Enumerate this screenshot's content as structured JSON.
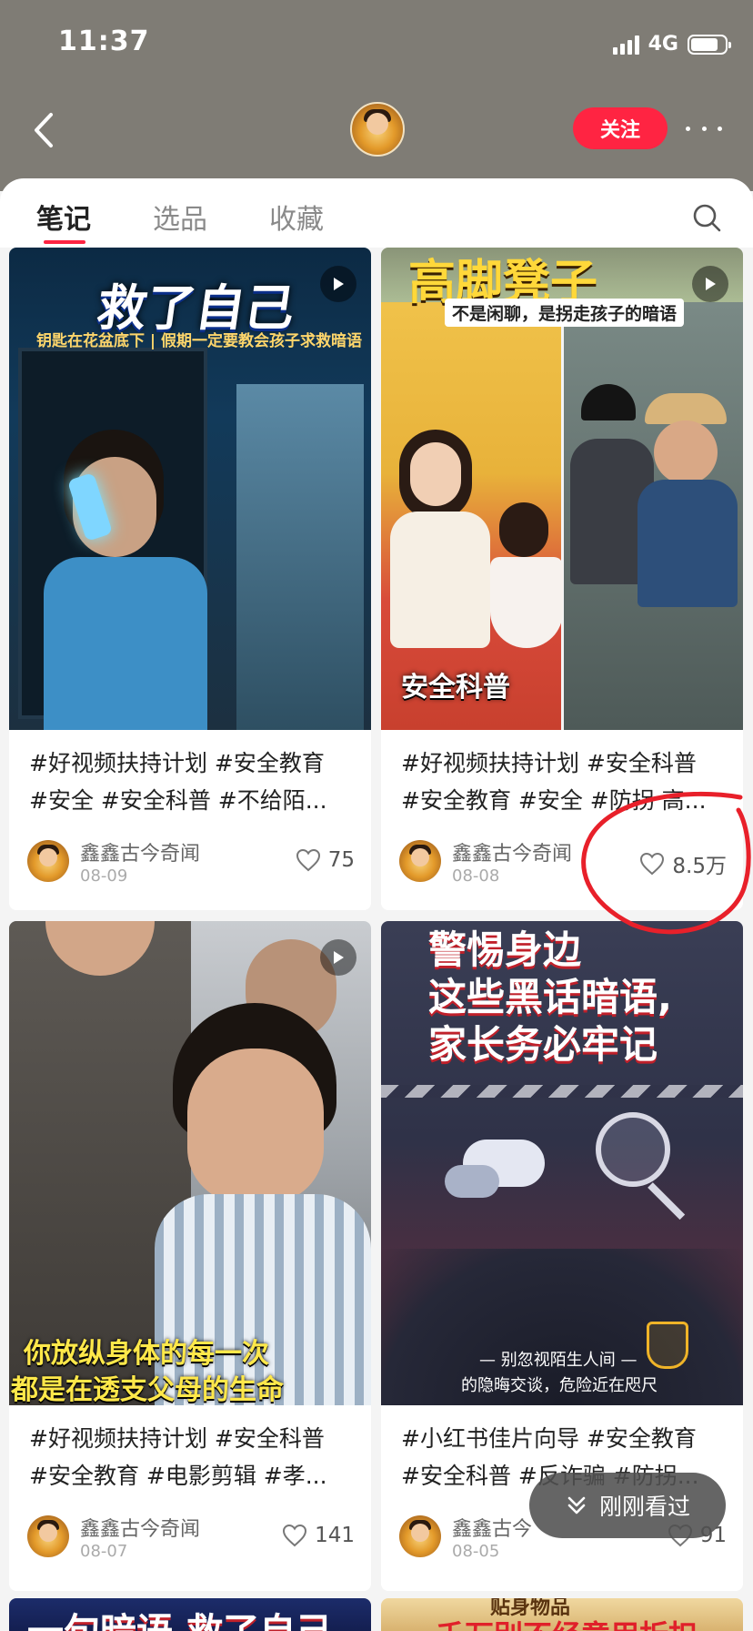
{
  "status_bar": {
    "time": "11:37",
    "network": "4G",
    "battery_level": 0.8
  },
  "header": {
    "follow_label": "关注"
  },
  "tabs": [
    {
      "label": "笔记",
      "active": true
    },
    {
      "label": "选品",
      "active": false
    },
    {
      "label": "收藏",
      "active": false
    }
  ],
  "notes": [
    {
      "tags_line1": "#好视频扶持计划 #安全教育",
      "tags_line2": "#安全 #安全科普 #不给陌...",
      "author": "鑫鑫古今奇闻",
      "date": "08-09",
      "likes": "75",
      "cover_text": [
        "救了自己",
        "钥匙在花盆底下 | 假期一定要教会孩子求救暗语"
      ]
    },
    {
      "tags_line1": "#好视频扶持计划 #安全科普",
      "tags_line2": "#安全教育 #安全 #防拐 高...",
      "author": "鑫鑫古今奇闻",
      "date": "08-08",
      "likes": "8.5万",
      "cover_text": [
        "高脚凳子",
        "不是闲聊，是拐走孩子的暗语",
        "安全科普"
      ]
    },
    {
      "tags_line1": "#好视频扶持计划 #安全科普",
      "tags_line2": "#安全教育 #电影剪辑 #孝...",
      "author": "鑫鑫古今奇闻",
      "date": "08-07",
      "likes": "141",
      "cover_text": [
        "你放纵身体的每一次",
        "都是在透支父母的生命"
      ]
    },
    {
      "tags_line1": "#小红书佳片向导 #安全教育",
      "tags_line2": "#安全科普 #反诈骗 #防拐...",
      "author": "鑫鑫古今",
      "date": "08-05",
      "likes": "91",
      "cover_text": [
        "警惕身边",
        "这些黑话暗语,",
        "家长务必牢记",
        "— 别忽视陌生人间 —",
        "的隐晦交谈，危险近在咫尺"
      ]
    }
  ],
  "bottom_peek": [
    "一句暗语,救了自己",
    "贴身物品",
    "千万别不经意用折扣"
  ],
  "recent_button_label": "刚刚看过",
  "colors": {
    "accent": "#ff2442",
    "header_bg": "#7f7c75",
    "annotation": "#e8202a"
  }
}
